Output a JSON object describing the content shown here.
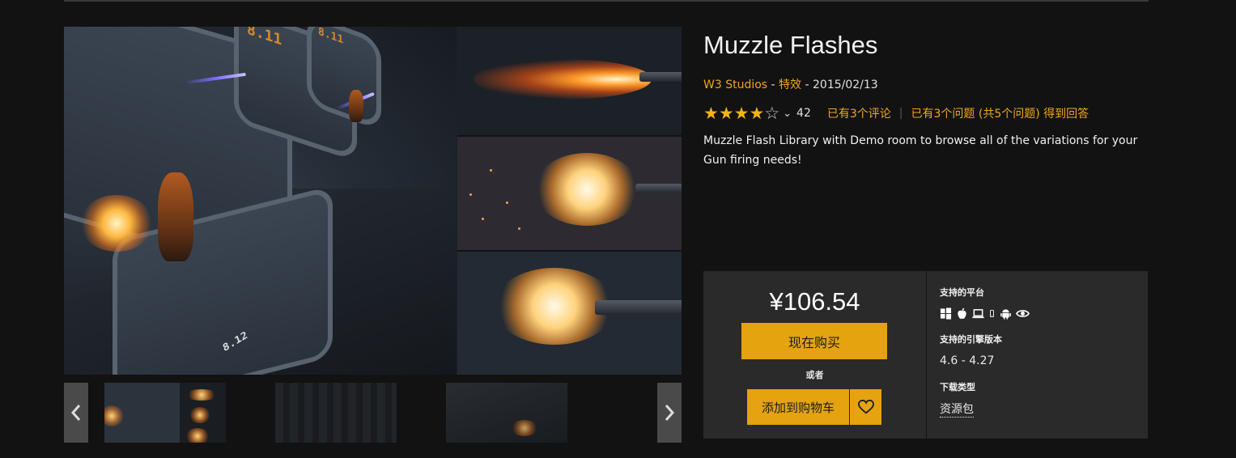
{
  "product": {
    "title": "Muzzle Flashes",
    "seller": "W3 Studios",
    "meta_sep1": " - ",
    "category": "特效",
    "meta_sep2": " - ",
    "date": "2015/02/13",
    "rating": 4,
    "rating_max": 5,
    "rating_count": "42",
    "reviews_link": "已有3个评论",
    "questions_link": "已有3个问题 (共5个问题) 得到回答",
    "description": "Muzzle Flash Library with Demo room to browse all of the variations for your Gun firing needs!"
  },
  "gallery": {
    "main_image_icon": "screenshot-muzzle-flash-demo-room",
    "panel_numbers": [
      "8.11",
      "8.11",
      "8.12"
    ],
    "thumbnails": [
      "thumbnail-1",
      "thumbnail-2",
      "thumbnail-3"
    ],
    "prev_icon": "chevron-left-icon",
    "next_icon": "chevron-right-icon"
  },
  "purchase": {
    "price": "¥106.54",
    "buy_now": "现在购买",
    "or": "或者",
    "add_to_cart": "添加到购物车",
    "wishlist_icon": "heart-icon"
  },
  "specs": {
    "platforms_label": "支持的平台",
    "platform_icons": [
      "windows-icon",
      "apple-icon",
      "laptop-icon",
      "mobile-icon",
      "android-icon",
      "eye-icon"
    ],
    "engine_label": "支持的引擎版本",
    "engine_versions": "4.6 - 4.27",
    "download_label": "下载类型",
    "download_type": "资源包"
  },
  "colors": {
    "accent": "#e4a30f",
    "link": "#f0a818",
    "background": "#121212",
    "panel": "#2a2a2a"
  }
}
